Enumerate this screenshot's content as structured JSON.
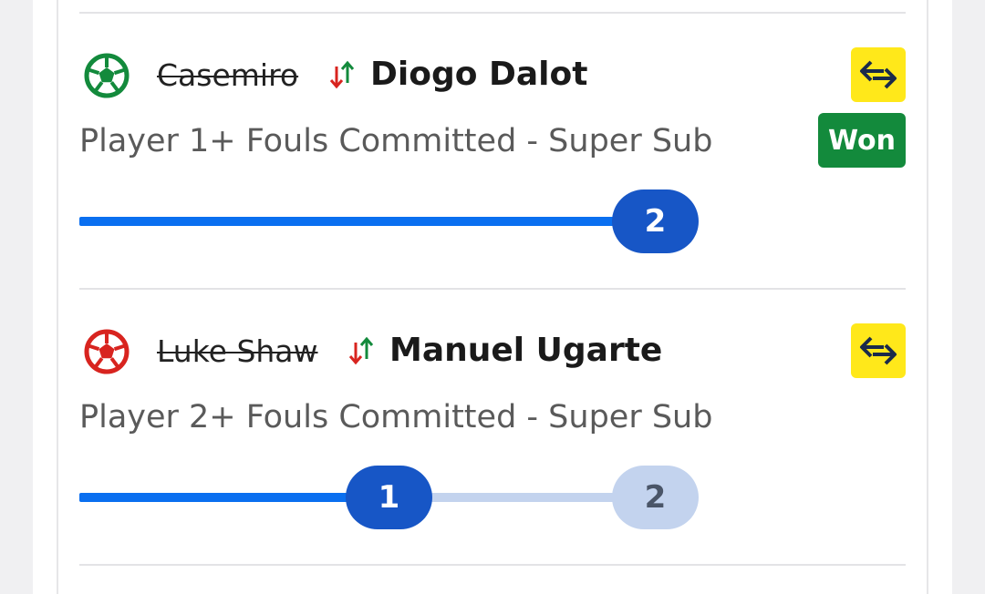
{
  "colors": {
    "accent_blue": "#0a6ff0",
    "pill_blue": "#1756c6",
    "pill_pending": "#c3d3ee",
    "won_green": "#138a3c",
    "ball_green": "#138a3c",
    "ball_red": "#d8241f",
    "swap_yellow": "#ffe81a"
  },
  "bets": [
    {
      "ball_icon": "football-icon",
      "ball_color": "green",
      "player_out": "Casemiro",
      "player_in": "Diogo Dalot",
      "market": "Player 1+ Fouls Committed - Super Sub",
      "status": "Won",
      "progress": {
        "current": 2,
        "target": 2,
        "markers": [
          "2"
        ]
      }
    },
    {
      "ball_icon": "football-icon",
      "ball_color": "red",
      "player_out": "Luke Shaw",
      "player_in": "Manuel Ugarte",
      "market": "Player 2+ Fouls Committed - Super Sub",
      "status": "",
      "progress": {
        "current": 1,
        "target": 2,
        "markers": [
          "1",
          "2"
        ]
      }
    }
  ]
}
